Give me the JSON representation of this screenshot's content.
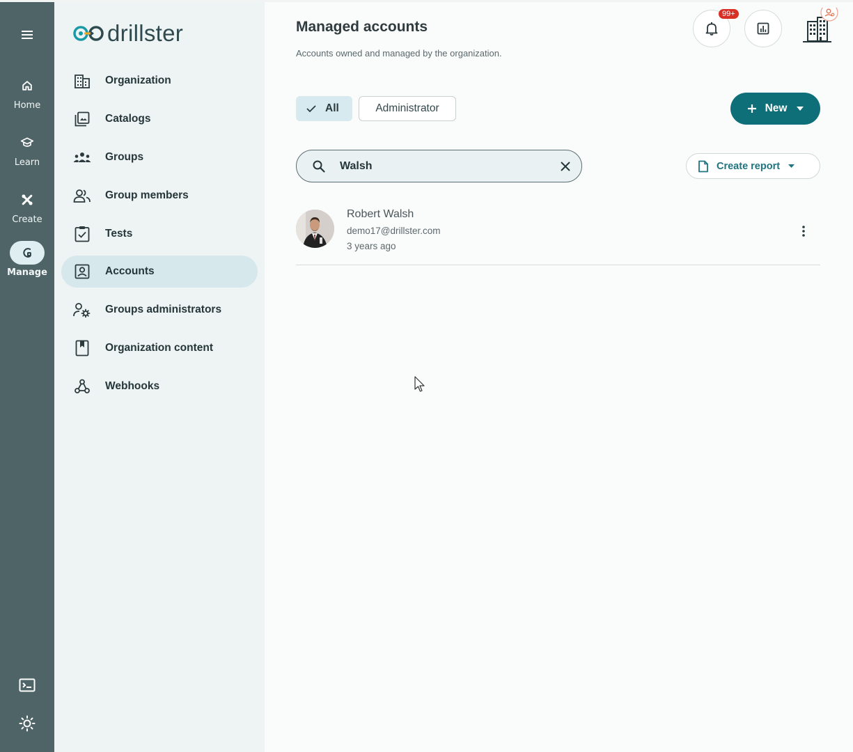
{
  "brand": {
    "name": "drillster",
    "accent": "#0e6f78"
  },
  "rail": {
    "items": [
      {
        "label": "Home",
        "icon": "home-icon"
      },
      {
        "label": "Learn",
        "icon": "graduation-cap-icon"
      },
      {
        "label": "Create",
        "icon": "tools-icon"
      },
      {
        "label": "Manage",
        "icon": "manage-icon",
        "active": true
      }
    ],
    "bottom": [
      {
        "icon": "terminal-icon"
      },
      {
        "icon": "brightness-icon"
      }
    ]
  },
  "sidebar": {
    "items": [
      {
        "label": "Organization",
        "icon": "building-icon"
      },
      {
        "label": "Catalogs",
        "icon": "catalog-icon"
      },
      {
        "label": "Groups",
        "icon": "groups-icon"
      },
      {
        "label": "Group members",
        "icon": "group-members-icon"
      },
      {
        "label": "Tests",
        "icon": "checkbox-icon"
      },
      {
        "label": "Accounts",
        "icon": "account-box-icon",
        "active": true
      },
      {
        "label": "Groups administrators",
        "icon": "admin-gear-icon"
      },
      {
        "label": "Organization content",
        "icon": "bookmark-icon"
      },
      {
        "label": "Webhooks",
        "icon": "webhook-icon"
      }
    ]
  },
  "header": {
    "title": "Managed accounts",
    "subtitle": "Accounts owned and managed by the organization.",
    "notifications_badge": "99+"
  },
  "filters": {
    "all_label": "All",
    "administrator_label": "Administrator"
  },
  "actions": {
    "new_label": "New",
    "create_report_label": "Create report"
  },
  "search": {
    "value": "Walsh"
  },
  "accounts": [
    {
      "name": "Robert Walsh",
      "email": "demo17@drillster.com",
      "time": "3 years ago"
    }
  ]
}
